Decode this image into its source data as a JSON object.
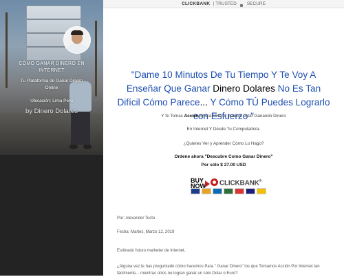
{
  "topbar": {
    "brand": "CLICKBANK",
    "trusted": "| TRUSTED",
    "secure": "SECURE"
  },
  "hero": {
    "title_line1": "CÓMO GANAR DINERO EN",
    "title_line2": "INTERNET",
    "desc_line1": "Tu Plataforma de Ganar Dinero",
    "desc_line2": "Online",
    "location": "Ubicación: Lima Perú",
    "by": "by Dinero Dolares"
  },
  "headline": {
    "part1": "\"Dame 10 Minutos De Tu Tiempo Y Te Voy A Enseñar Que Ganar ",
    "part2": "Dinero Dolares",
    "part3": "  No Es Tan Difícil Cómo Parece",
    "part4": "... ",
    "part5": "Y Cómo TÚ Puedes Lograrlo con Esfuerzo",
    "part6": " \""
  },
  "body": {
    "p1_a": "Y Si Tomas ",
    "p1_b": "Acción",
    "p1_c": " Ahora Mismo, Puedes estar Ganando Dinero",
    "p2": "En Internet Y Desde Tu Computadora.",
    "p3": "¿Quieres Ver  y  Aprender Cómo Lo Hago?",
    "order": "Ordene ahora \"Descubre Como Ganar Dinero\"",
    "price": "Por sólo $ 27.00 USD"
  },
  "badge": {
    "buy": "BUY",
    "now": "NOW",
    "brand": "CLICKBANK",
    "trademark": "®"
  },
  "letter": {
    "author": "Por: Alexander Tocto",
    "date": "Fecha: Martes, Marzo 12, 2019",
    "greeting": "Estimado futuro marketer de Internet,",
    "question": "¿Alguna vez te has preguntado cómo hacemos Para \" Ganar Dinero\" los que Tomamos Acción Por Internet tan fácilmente... mientras otros no logran ganar un sólo Dolar o Euro?"
  },
  "colors": {
    "headline": "#1e4fb0",
    "hero_bottom": "#232323",
    "clickbank_red": "#c41f1f"
  }
}
